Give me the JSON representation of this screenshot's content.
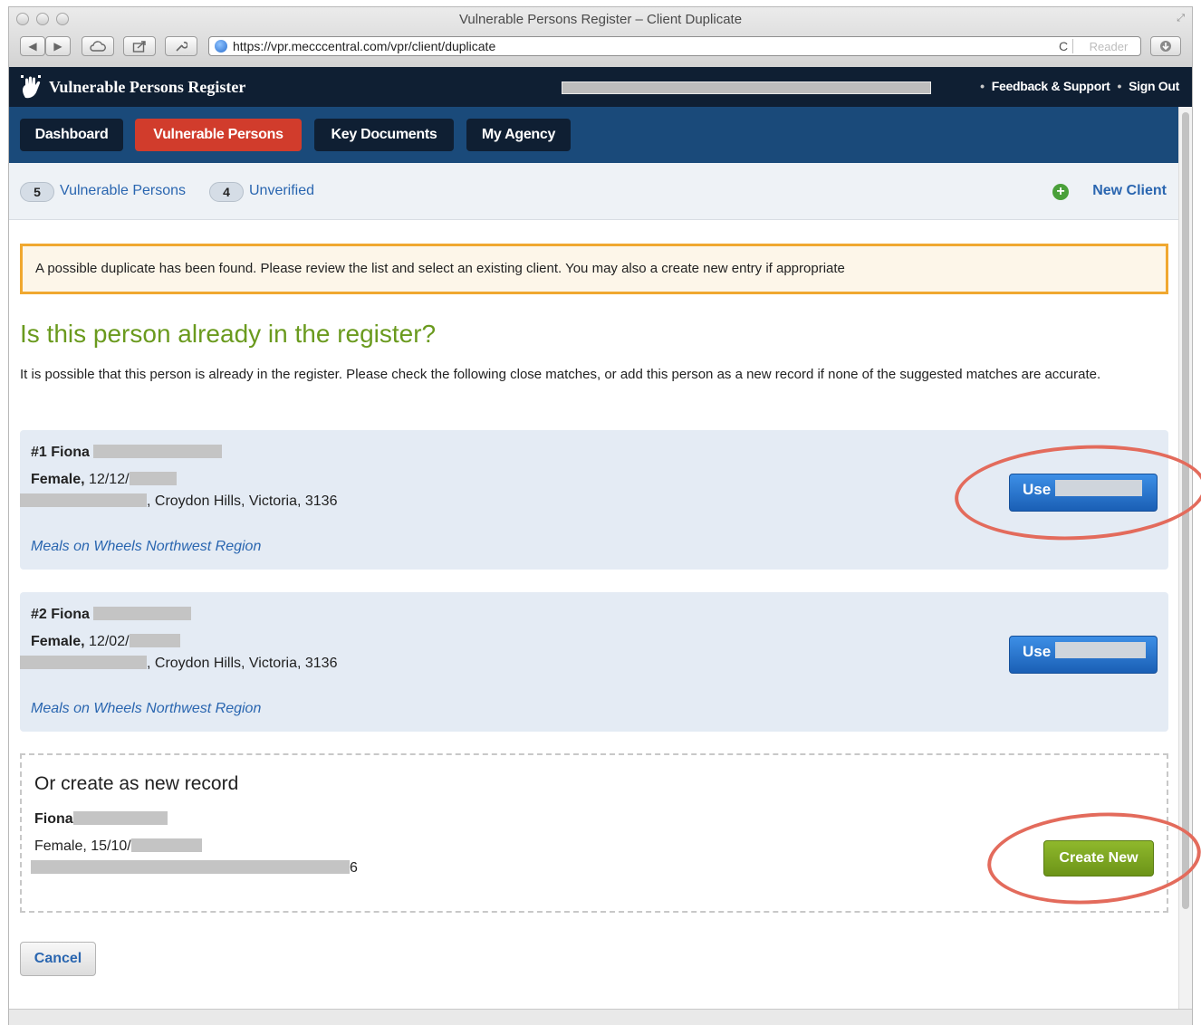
{
  "window": {
    "title": "Vulnerable Persons Register – Client Duplicate",
    "url": "https://vpr.mecccentral.com/vpr/client/duplicate",
    "reload_icon": "C",
    "reader_label": "Reader"
  },
  "header": {
    "app_title": "Vulnerable Persons Register",
    "links": [
      "Feedback & Support",
      "Sign Out"
    ]
  },
  "nav": {
    "tabs": [
      {
        "label": "Dashboard",
        "active": false
      },
      {
        "label": "Vulnerable Persons",
        "active": true
      },
      {
        "label": "Key Documents",
        "active": false
      },
      {
        "label": "My Agency",
        "active": false
      }
    ]
  },
  "subbar": {
    "vulnerable_count": "5",
    "vulnerable_label": "Vulnerable Persons",
    "unverified_count": "4",
    "unverified_label": "Unverified",
    "new_client_label": "New Client"
  },
  "alert": {
    "text": "A possible duplicate has been found. Please review the list and select an existing client. You may also a create new entry if appropriate"
  },
  "main": {
    "heading": "Is this person already in the register?",
    "intro": "It is possible that this person is already in the register. Please check the following close matches, or add this person as a new record if none of the suggested matches are accurate."
  },
  "matches": [
    {
      "name": "#1 Fiona",
      "gender": "Female,",
      "dob": "12/12/",
      "address": ", Croydon Hills, Victoria, 3136",
      "agency": "Meals on Wheels Northwest Region",
      "use_label": "Use"
    },
    {
      "name": "#2 Fiona",
      "gender": "Female,",
      "dob": "12/02/",
      "address": ", Croydon Hills, Victoria, 3136",
      "agency": "Meals on Wheels Northwest Region",
      "use_label": "Use"
    }
  ],
  "new_record": {
    "title": "Or create as new record",
    "name": "Fiona",
    "gender_dob": "Female, 15/10/",
    "address_tail": "6",
    "create_label": "Create New"
  },
  "cancel_label": "Cancel",
  "colors": {
    "header_bg": "#0f1f33",
    "nav_bg": "#1a4a7a",
    "active_tab": "#d13c2c",
    "heading_green": "#6a9a1e",
    "link_blue": "#2a66b0",
    "alert_border": "#f0a830",
    "use_button": "#1a5fb5",
    "create_button": "#7aa320",
    "annotation": "#e36b5c"
  }
}
